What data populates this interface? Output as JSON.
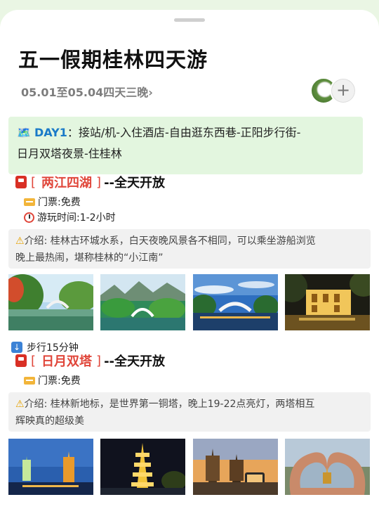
{
  "header": {
    "title": "五一假期桂林四天游",
    "subtitle": "05.01至05.04四天三晚",
    "subtitle_chevron": "›",
    "add_label": "+"
  },
  "day1": {
    "icon": "map-icon",
    "label": "DAY1",
    "text_line1": "：接站/机-入住酒店-自由逛东西巷-正阳步行街-",
    "text_line2": "日月双塔夜景-住桂林"
  },
  "spots": [
    {
      "bracket_open": "[",
      "name": "两江四湖",
      "bracket_close": "]",
      "open": "--全天开放",
      "ticket": "门票:免费",
      "time": "游玩时间:1-2小时",
      "intro_prefix": "介绍",
      "intro_line1": ": 桂林古环城水系，白天夜晚风景各不相同，可以乘坐游船浏览",
      "intro_line2": "晚上最热闹，堪称桂林的“小江南”"
    },
    {
      "bracket_open": "[",
      "name": "日月双塔",
      "bracket_close": "]",
      "open": "--全天开放",
      "ticket": "门票:免费",
      "intro_prefix": "介绍",
      "intro_line1": ": 桂林新地标，是世界第一铜塔，晚上19-22点亮灯，两塔相互",
      "intro_line2": "辉映真的超级美"
    }
  ],
  "walk_text": "步行15分钟",
  "colors": {
    "accent_red": "#e0463a",
    "banner_green": "#e3f6df",
    "day_blue": "#1a7ac8"
  }
}
